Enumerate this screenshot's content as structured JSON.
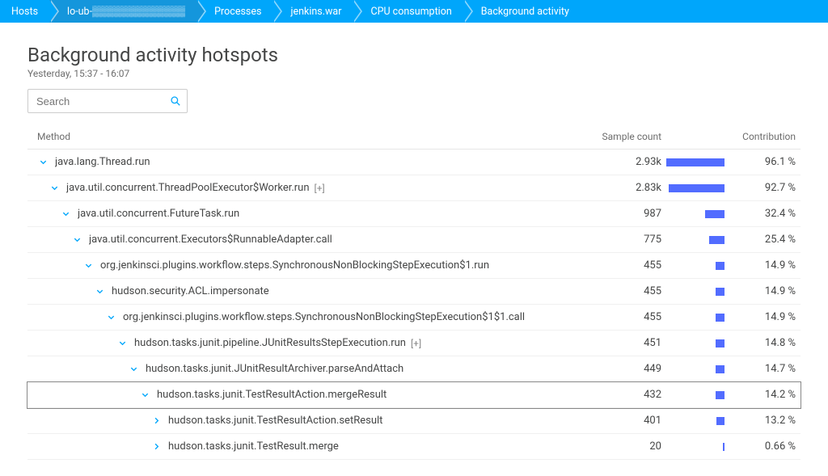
{
  "breadcrumb": [
    {
      "label": "Hosts"
    },
    {
      "label": "lo-ub-▒▒▒▒▒▒▒▒▒▒▒▒▒"
    },
    {
      "label": "Processes"
    },
    {
      "label": "jenkins.war"
    },
    {
      "label": "CPU consumption"
    },
    {
      "label": "Background activity"
    }
  ],
  "header": {
    "title": "Background activity hotspots",
    "subtitle": "Yesterday, 15:37 - 16:07"
  },
  "search": {
    "placeholder": "Search"
  },
  "columns": {
    "method": "Method",
    "sample": "Sample count",
    "contribution": "Contribution"
  },
  "rows": [
    {
      "indent": 0,
      "chevron": "down",
      "method": "java.lang.Thread.run",
      "badge": "",
      "sample": "2.93k",
      "pct": 96.1
    },
    {
      "indent": 1,
      "chevron": "down",
      "method": "java.util.concurrent.ThreadPoolExecutor$Worker.run",
      "badge": "[+]",
      "sample": "2.83k",
      "pct": 92.7
    },
    {
      "indent": 2,
      "chevron": "down",
      "method": "java.util.concurrent.FutureTask.run",
      "badge": "",
      "sample": "987",
      "pct": 32.4
    },
    {
      "indent": 3,
      "chevron": "down",
      "method": "java.util.concurrent.Executors$RunnableAdapter.call",
      "badge": "",
      "sample": "775",
      "pct": 25.4
    },
    {
      "indent": 4,
      "chevron": "down",
      "method": "org.jenkinsci.plugins.workflow.steps.SynchronousNonBlockingStepExecution$1.run",
      "badge": "",
      "sample": "455",
      "pct": 14.9
    },
    {
      "indent": 5,
      "chevron": "down",
      "method": "hudson.security.ACL.impersonate",
      "badge": "",
      "sample": "455",
      "pct": 14.9
    },
    {
      "indent": 6,
      "chevron": "down",
      "method": "org.jenkinsci.plugins.workflow.steps.SynchronousNonBlockingStepExecution$1$1.call",
      "badge": "",
      "sample": "455",
      "pct": 14.9
    },
    {
      "indent": 7,
      "chevron": "down",
      "method": "hudson.tasks.junit.pipeline.JUnitResultsStepExecution.run",
      "badge": "[+]",
      "sample": "451",
      "pct": 14.8
    },
    {
      "indent": 8,
      "chevron": "down",
      "method": "hudson.tasks.junit.JUnitResultArchiver.parseAndAttach",
      "badge": "",
      "sample": "449",
      "pct": 14.7
    },
    {
      "indent": 9,
      "chevron": "down",
      "method": "hudson.tasks.junit.TestResultAction.mergeResult",
      "badge": "",
      "sample": "432",
      "pct": 14.2,
      "selected": true
    },
    {
      "indent": 10,
      "chevron": "right",
      "method": "hudson.tasks.junit.TestResultAction.setResult",
      "badge": "",
      "sample": "401",
      "pct": 13.2
    },
    {
      "indent": 10,
      "chevron": "right",
      "method": "hudson.tasks.junit.TestResult.merge",
      "badge": "",
      "sample": "20",
      "pct": 0.66
    }
  ],
  "colors": {
    "accent": "#00a6fb",
    "bar": "#526cff"
  }
}
